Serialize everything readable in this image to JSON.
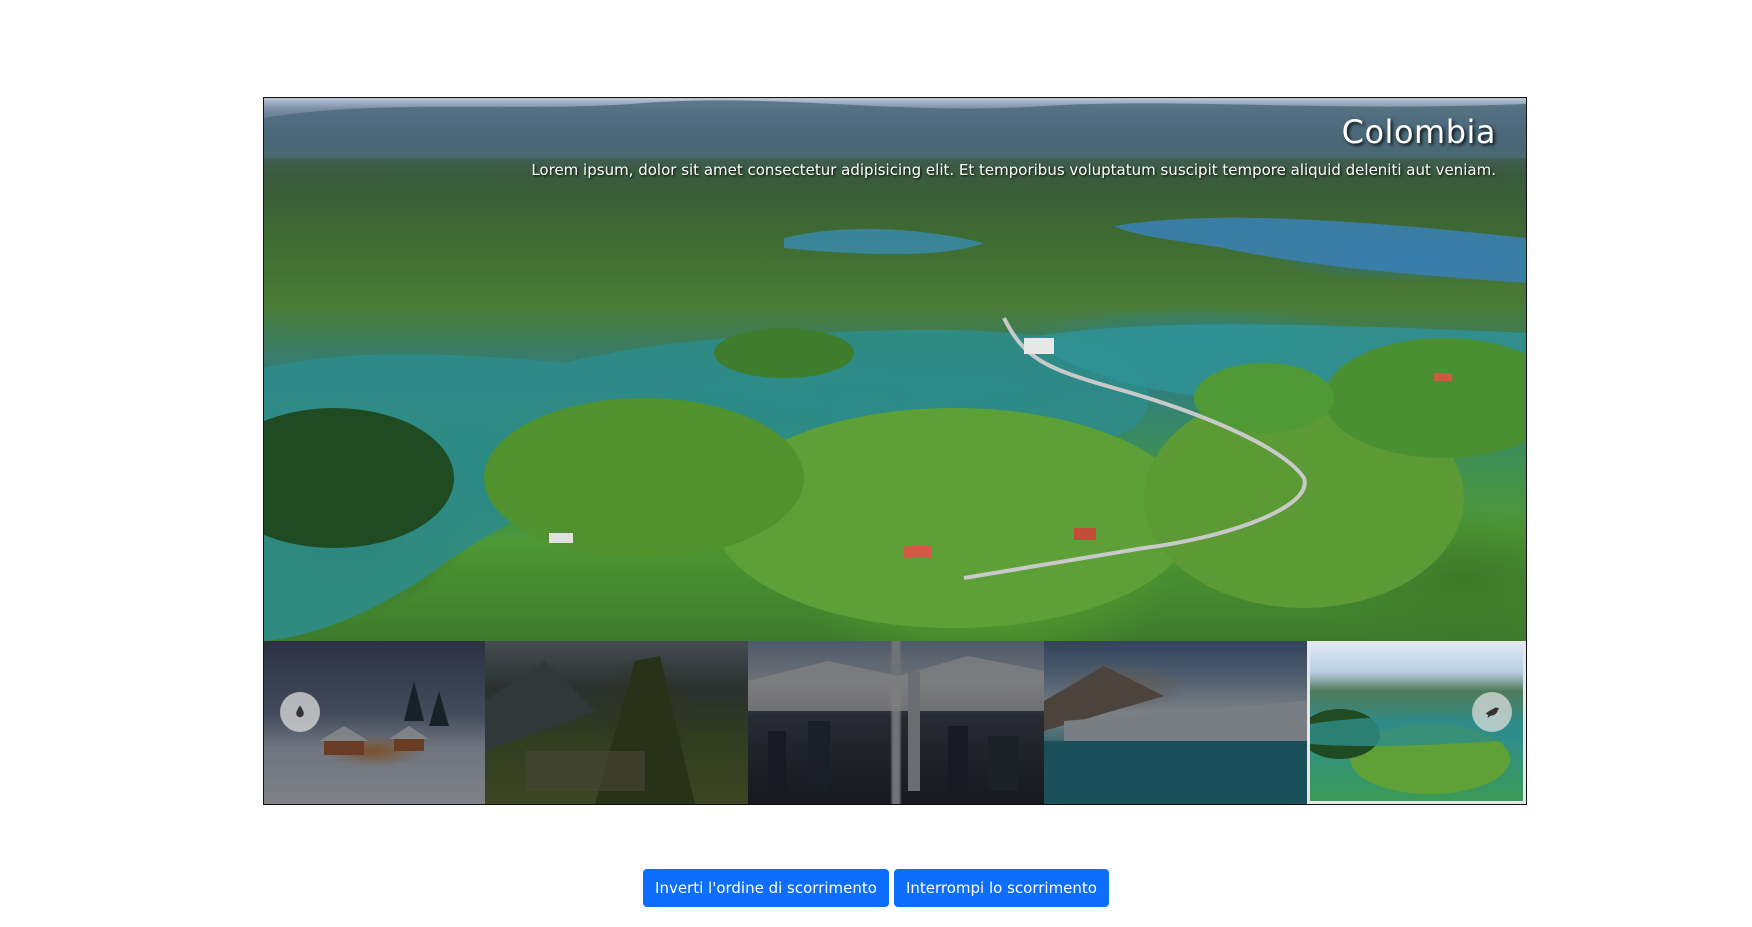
{
  "slider": {
    "caption": {
      "title": "Colombia",
      "text": "Lorem ipsum, dolor sit amet consectetur adipisicing elit. Et temporibus voluptatum suscipit tempore aliquid deleniti aut veniam."
    },
    "thumbnails": [
      {
        "name": "snowy-village",
        "active": false
      },
      {
        "name": "machu-picchu",
        "active": false
      },
      {
        "name": "city-skyline",
        "active": false
      },
      {
        "name": "glacier",
        "active": false
      },
      {
        "name": "colombia-lake",
        "active": true
      }
    ],
    "prev_icon": "drop-icon",
    "next_icon": "bird-icon"
  },
  "controls": {
    "reverse_label": "Inverti l'ordine di scorrimento",
    "stop_label": "Interrompi lo scorrimento"
  },
  "colors": {
    "button": "#0d6efd",
    "active_thumb_border": "#e6e6e6"
  }
}
